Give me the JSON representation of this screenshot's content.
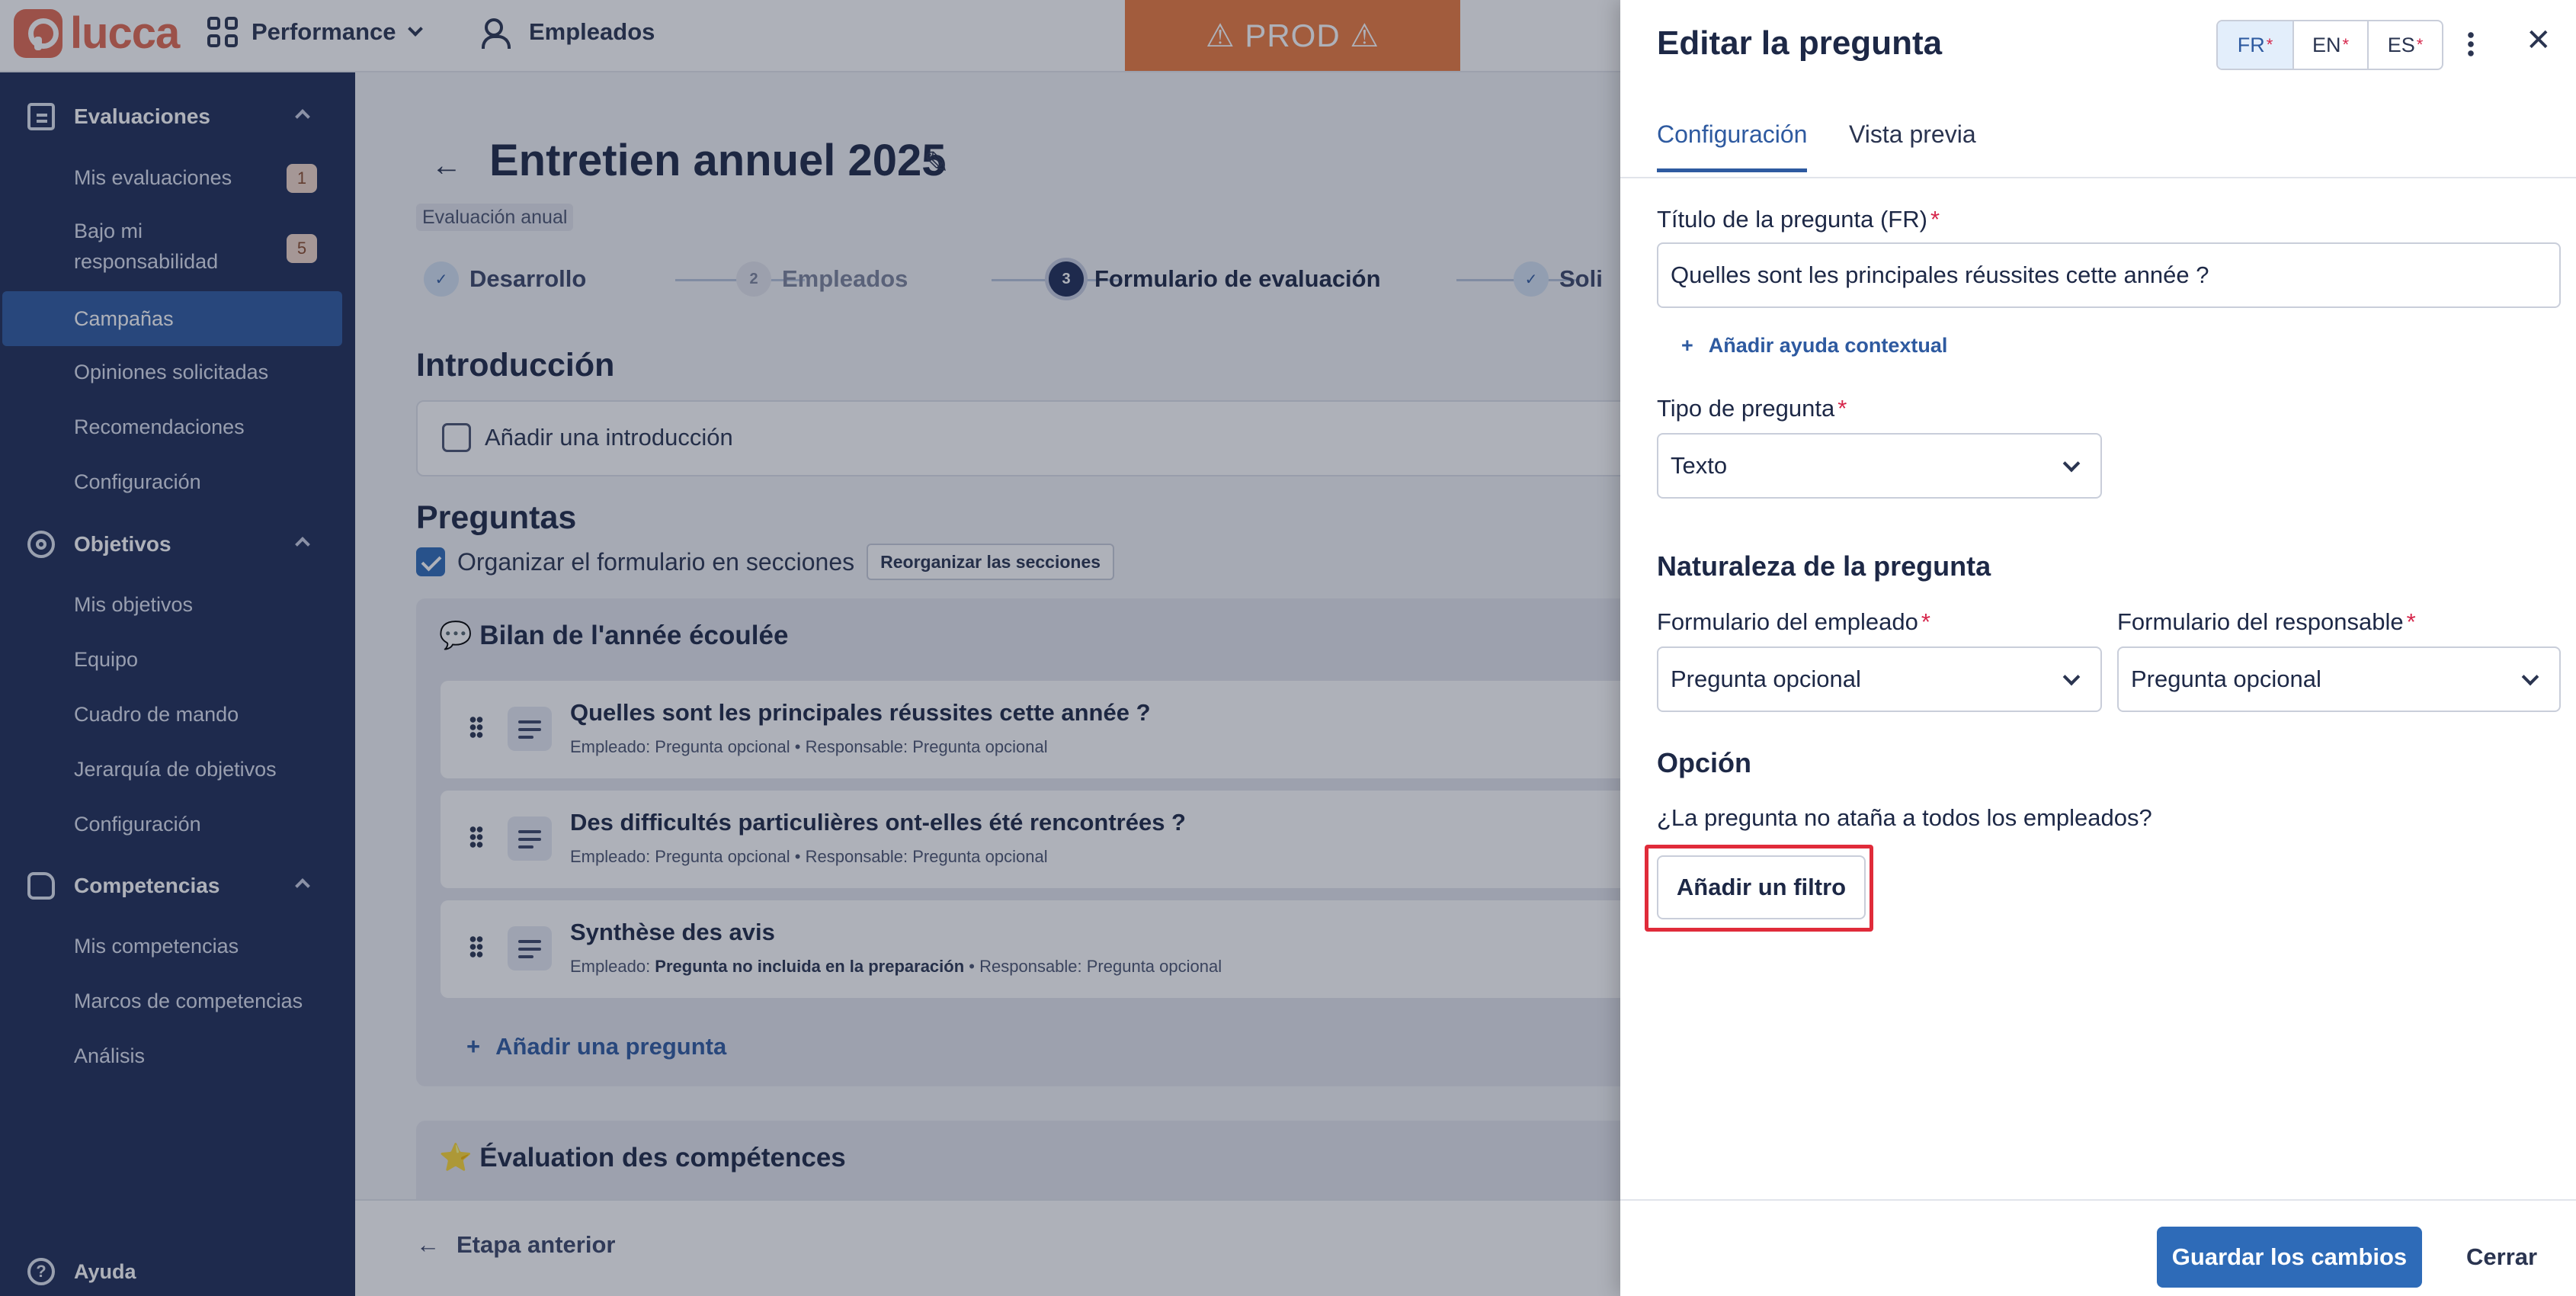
{
  "app": {
    "logo_text": "lucca",
    "module_switcher": "Performance",
    "nav_people": "Empleados",
    "env_banner": "⚠ PROD ⚠"
  },
  "sidebar": {
    "groups": [
      {
        "label": "Evaluaciones",
        "icon": "chat-icon"
      },
      {
        "label": "Objetivos",
        "icon": "target-icon"
      },
      {
        "label": "Competencias",
        "icon": "puzzle-icon"
      }
    ],
    "evaluaciones_items": [
      {
        "label": "Mis evaluaciones",
        "badge": "1"
      },
      {
        "label": "Bajo mi responsabilidad",
        "badge": "5"
      },
      {
        "label": "Campañas",
        "active": true
      },
      {
        "label": "Opiniones solicitadas"
      },
      {
        "label": "Recomendaciones"
      },
      {
        "label": "Configuración"
      }
    ],
    "objetivos_items": [
      {
        "label": "Mis objetivos"
      },
      {
        "label": "Equipo"
      },
      {
        "label": "Cuadro de mando"
      },
      {
        "label": "Jerarquía de objetivos"
      },
      {
        "label": "Configuración"
      }
    ],
    "competencias_items": [
      {
        "label": "Mis competencias"
      },
      {
        "label": "Marcos de competencias"
      },
      {
        "label": "Análisis"
      }
    ],
    "help": "Ayuda"
  },
  "main": {
    "title": "Entretien annuel 2025",
    "subtitle_tag": "Evaluación anual",
    "steps": [
      {
        "number": "✓",
        "label": "Desarrollo",
        "state": "done"
      },
      {
        "number": "2",
        "label": "Empleados",
        "state": "todo"
      },
      {
        "number": "3",
        "label": "Formulario de evaluación",
        "state": "current"
      },
      {
        "number": "✓",
        "label": "Soli",
        "state": "done"
      }
    ],
    "intro_heading": "Introducción",
    "intro_checkbox": "Añadir una introducción",
    "questions_heading": "Preguntas",
    "organize_checkbox": "Organizar el formulario en secciones",
    "reorganize_button": "Reorganizar las secciones",
    "sections": [
      {
        "title": "💬 Bilan de l'année écoulée",
        "questions": [
          {
            "title": "Quelles sont les principales réussites cette année ?",
            "employee_prefix": "Empleado: ",
            "employee_value": "Pregunta opcional",
            "separator": " • ",
            "manager": "Responsable: Pregunta opcional"
          },
          {
            "title": "Des difficultés particulières ont-elles été rencontrées ?",
            "employee_prefix": "Empleado: ",
            "employee_value": "Pregunta opcional",
            "separator": " • ",
            "manager": "Responsable: Pregunta opcional"
          },
          {
            "title": "Synthèse des avis",
            "employee_prefix": "Empleado: ",
            "employee_value": "Pregunta no incluida en la preparación",
            "separator": " • ",
            "manager": "Responsable: Pregunta opcional"
          }
        ],
        "add_question": "Añadir una pregunta"
      },
      {
        "title": "⭐ Évaluation des compétences"
      }
    ],
    "prev_step": "Etapa anterior"
  },
  "panel": {
    "title": "Editar la pregunta",
    "languages": [
      {
        "code": "FR",
        "required": "*"
      },
      {
        "code": "EN",
        "required": "*"
      },
      {
        "code": "ES",
        "required": "*"
      }
    ],
    "tabs": [
      "Configuración",
      "Vista previa"
    ],
    "title_label": "Título de la pregunta (FR)",
    "required_mark": "*",
    "title_value": "Quelles sont les principales réussites cette année ?",
    "add_context_help": "Añadir ayuda contextual",
    "type_label": "Tipo de pregunta",
    "type_value": "Texto",
    "nature_heading": "Naturaleza de la pregunta",
    "employee_form_label": "Formulario del empleado",
    "employee_form_value": "Pregunta opcional",
    "manager_form_label": "Formulario del responsable",
    "manager_form_value": "Pregunta opcional",
    "option_heading": "Opción",
    "option_question": "¿La pregunta no ataña a todos los empleados?",
    "add_filter_button": "Añadir un filtro",
    "save_button": "Guardar los cambios",
    "close_button": "Cerrar"
  },
  "colors": {
    "sidebar_bg": "#1e2d57",
    "accent": "#2e6bb8",
    "brand": "#e26a50",
    "prod_banner": "#ed7a3e",
    "highlight": "#e02b3a"
  }
}
